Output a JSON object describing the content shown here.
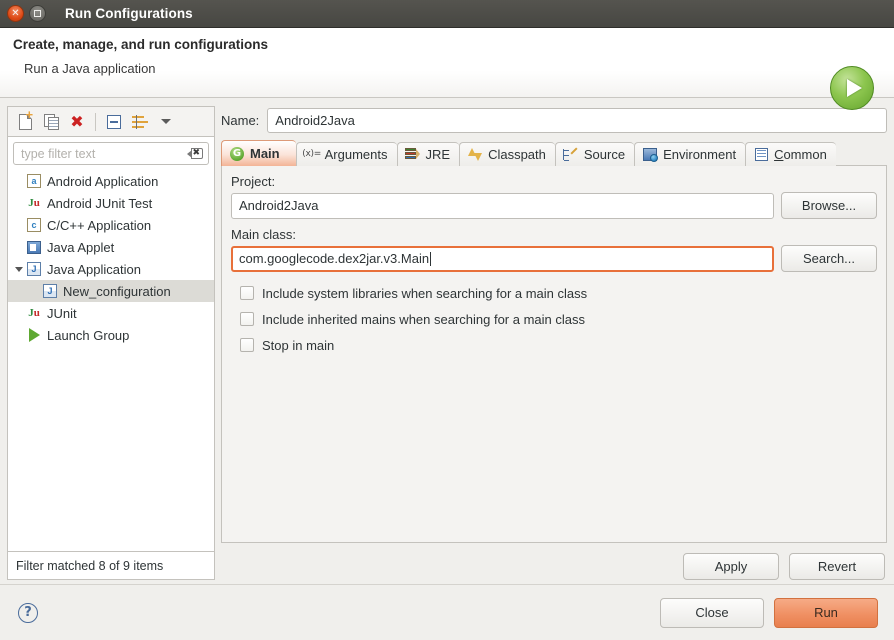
{
  "window": {
    "title": "Run Configurations",
    "close_icon": "close-icon",
    "maximize_icon": "maximize-icon"
  },
  "banner": {
    "title": "Create, manage, and run configurations",
    "subtitle": "Run a Java application",
    "icon": "run-play-icon"
  },
  "toolbar": {
    "buttons": [
      {
        "name": "new-launch-configuration",
        "icon": "new-document-icon"
      },
      {
        "name": "duplicate-launch-configuration",
        "icon": "copy-icon"
      },
      {
        "name": "delete-launch-configuration",
        "icon": "red-x-icon"
      },
      {
        "name": "collapse-all",
        "icon": "collapse-all-icon"
      },
      {
        "name": "filter-launch-configurations",
        "icon": "filter-icon"
      },
      {
        "name": "view-menu",
        "icon": "chevron-down-icon"
      }
    ]
  },
  "filter": {
    "placeholder": "type filter text",
    "value": "",
    "clear_icon": "clear-icon",
    "status": "Filter matched 8 of 9 items"
  },
  "tree": {
    "items": [
      {
        "label": "Android Application",
        "icon": "android-application-icon",
        "level": 0,
        "expandable": false,
        "selected": false
      },
      {
        "label": "Android JUnit Test",
        "icon": "junit-icon",
        "level": 0,
        "expandable": false,
        "selected": false
      },
      {
        "label": "C/C++ Application",
        "icon": "c-application-icon",
        "level": 0,
        "expandable": false,
        "selected": false
      },
      {
        "label": "Java Applet",
        "icon": "java-applet-icon",
        "level": 0,
        "expandable": false,
        "selected": false
      },
      {
        "label": "Java Application",
        "icon": "java-application-icon",
        "level": 0,
        "expandable": true,
        "expanded": true,
        "selected": false
      },
      {
        "label": "New_configuration",
        "icon": "java-application-icon",
        "level": 1,
        "expandable": false,
        "selected": true
      },
      {
        "label": "JUnit",
        "icon": "junit-icon",
        "level": 0,
        "expandable": false,
        "selected": false
      },
      {
        "label": "Launch Group",
        "icon": "launch-group-icon",
        "level": 0,
        "expandable": false,
        "selected": false
      }
    ]
  },
  "name_field": {
    "label": "Name:",
    "value": "Android2Java"
  },
  "tabs": [
    {
      "label": "Main",
      "icon": "main-tab-icon",
      "active": true
    },
    {
      "label": "Arguments",
      "icon": "arguments-icon",
      "active": false
    },
    {
      "label": "JRE",
      "icon": "jre-icon",
      "active": false
    },
    {
      "label": "Classpath",
      "icon": "classpath-icon",
      "active": false
    },
    {
      "label": "Source",
      "icon": "source-icon",
      "active": false
    },
    {
      "label": "Environment",
      "icon": "environment-icon",
      "active": false
    },
    {
      "label": "Common",
      "icon": "common-icon",
      "active": false,
      "mnemonic": "C",
      "rest": "ommon"
    }
  ],
  "main_tab": {
    "project": {
      "label": "Project:",
      "value": "Android2Java",
      "browse_label": "Browse..."
    },
    "main_class": {
      "label": "Main class:",
      "value": "com.googlecode.dex2jar.v3.Main",
      "search_label": "Search...",
      "focused": true,
      "focus_color": "#e8703a"
    },
    "checkboxes": [
      {
        "label": "Include system libraries when searching for a main class",
        "checked": false
      },
      {
        "label": "Include inherited mains when searching for a main class",
        "checked": false
      },
      {
        "label": "Stop in main",
        "checked": false
      }
    ]
  },
  "action_buttons": {
    "apply": "Apply",
    "revert": "Revert"
  },
  "footer": {
    "help_icon": "help-icon",
    "close": "Close",
    "run": "Run",
    "run_color": "#ef8f62"
  }
}
